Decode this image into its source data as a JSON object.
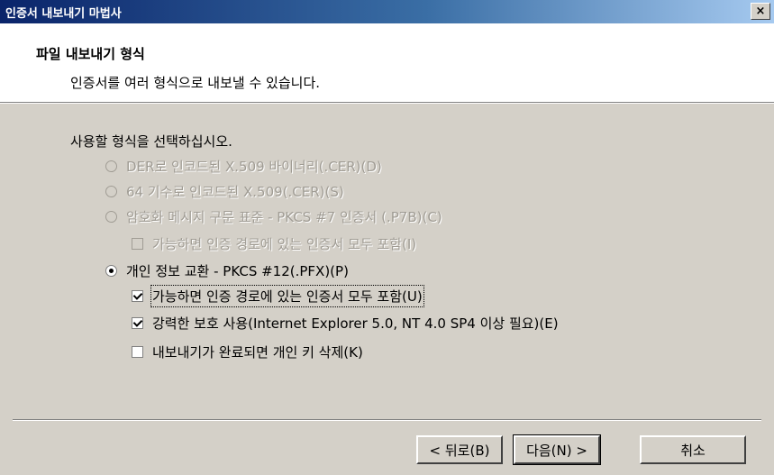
{
  "window": {
    "title": "인증서 내보내기 마법사",
    "close_glyph": "×"
  },
  "header": {
    "title": "파일 내보내기 형식",
    "subtitle": "인증서를 여러 형식으로 내보낼 수 있습니다."
  },
  "prompt": "사용할 형식을 선택하십시오.",
  "options": [
    {
      "label": "DER로 인코드된 X.509 바이너리(.CER)(D)",
      "selected": false,
      "enabled": false
    },
    {
      "label": "64 기수로 인코드된 X.509(.CER)(S)",
      "selected": false,
      "enabled": false
    },
    {
      "label": "암호화 메시지 구문 표준 - PKCS #7 인증서 (.P7B)(C)",
      "selected": false,
      "enabled": false
    },
    {
      "label": "개인 정보 교환 - PKCS #12(.PFX)(P)",
      "selected": true,
      "enabled": true
    }
  ],
  "checkboxes": [
    {
      "label": "가능하면 인증 경로에 있는 인증서 모두 포함(I)",
      "checked": false,
      "enabled": false
    },
    {
      "label": "가능하면 인증 경로에 있는 인증서 모두 포함(U)",
      "checked": true,
      "enabled": true
    },
    {
      "label": "강력한 보호 사용(Internet Explorer 5.0, NT 4.0 SP4 이상 필요)(E)",
      "checked": true,
      "enabled": true
    },
    {
      "label": "내보내기가 완료되면 개인 키 삭제(K)",
      "checked": false,
      "enabled": true
    }
  ],
  "buttons": {
    "back": "< 뒤로(B)",
    "next": "다음(N) >",
    "cancel": "취소"
  }
}
